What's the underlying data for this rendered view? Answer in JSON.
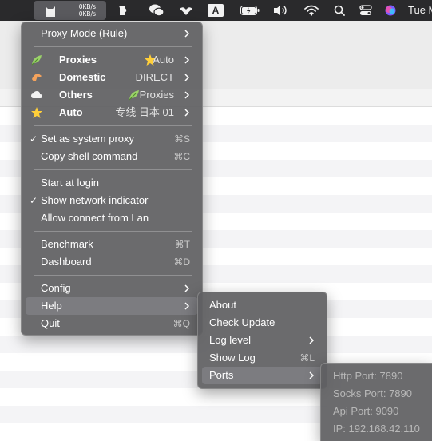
{
  "menubar": {
    "speed_up": "0KB/s",
    "speed_down": "0KB/s",
    "clock": "Tue M",
    "icons": [
      "clash-cat-icon",
      "pitcher-icon",
      "wechat-icon",
      "bird-icon",
      "input-method-icon",
      "battery-icon",
      "volume-icon",
      "wifi-icon",
      "search-icon",
      "control-center-icon",
      "siri-icon"
    ],
    "input_method_letter": "A"
  },
  "main_menu": {
    "proxy_mode": "Proxy Mode (Rule)",
    "groups": [
      {
        "label": "Proxies",
        "value": "Auto",
        "icon": "leaf-icon",
        "value_icon": "star-icon"
      },
      {
        "label": "Domestic",
        "value": "DIRECT",
        "icon": "hand-icon",
        "value_icon": ""
      },
      {
        "label": "Others",
        "value": "Proxies",
        "icon": "cloud-icon",
        "value_icon": "leaf-icon"
      },
      {
        "label": "Auto",
        "value": "专线 日本 01",
        "icon": "star-icon",
        "value_icon": ""
      }
    ],
    "set_system_proxy": "Set as system proxy",
    "set_system_proxy_shortcut": "⌘S",
    "copy_shell": "Copy shell command",
    "copy_shell_shortcut": "⌘C",
    "start_login": "Start at login",
    "show_indicator": "Show network indicator",
    "allow_lan": "Allow connect from Lan",
    "benchmark": "Benchmark",
    "benchmark_shortcut": "⌘T",
    "dashboard": "Dashboard",
    "dashboard_shortcut": "⌘D",
    "config": "Config",
    "help": "Help",
    "quit": "Quit",
    "quit_shortcut": "⌘Q"
  },
  "help_menu": {
    "about": "About",
    "check_update": "Check Update",
    "log_level": "Log level",
    "show_log": "Show Log",
    "show_log_shortcut": "⌘L",
    "ports": "Ports"
  },
  "ports_menu": {
    "http": "Http Port: 7890",
    "socks": "Socks Port: 7890",
    "api": "Api Port: 9090",
    "ip": "IP: 192.168.42.110"
  },
  "colors": {
    "menu_bg": "#606062",
    "highlight": "#7c7c80",
    "menubar_bg": "#2a2a2c"
  }
}
